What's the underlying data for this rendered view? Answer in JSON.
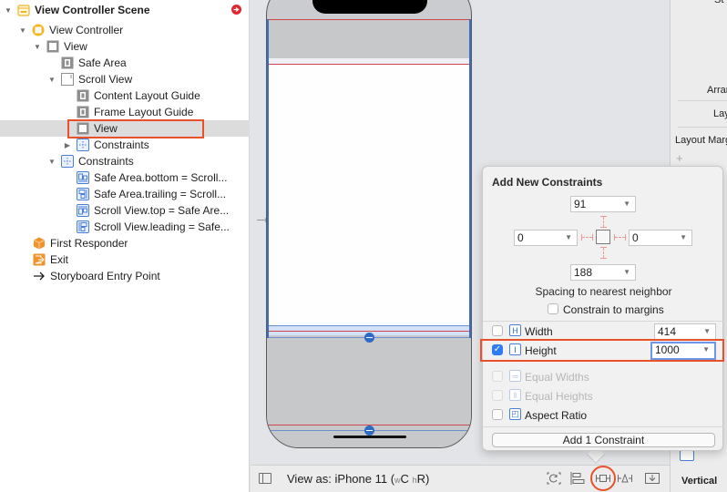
{
  "outline": {
    "items": [
      {
        "label": "View Controller Scene",
        "level": 0,
        "expanded": true,
        "icon": "scene-icon",
        "bold": true
      },
      {
        "label": "View Controller",
        "level": 1,
        "expanded": true,
        "icon": "view-controller-icon"
      },
      {
        "label": "View",
        "level": 2,
        "expanded": true,
        "icon": "view-icon"
      },
      {
        "label": "Safe Area",
        "level": 3,
        "icon": "layout-guide-icon"
      },
      {
        "label": "Scroll View",
        "level": 3,
        "expanded": true,
        "icon": "scroll-view-icon"
      },
      {
        "label": "Content Layout Guide",
        "level": 4,
        "icon": "layout-guide-icon"
      },
      {
        "label": "Frame Layout Guide",
        "level": 4,
        "icon": "layout-guide-icon"
      },
      {
        "label": "View",
        "level": 4,
        "icon": "view-icon",
        "selected": true
      },
      {
        "label": "Constraints",
        "level": 4,
        "expanded": false,
        "icon": "constraints-icon"
      },
      {
        "label": "Constraints",
        "level": 3,
        "expanded": true,
        "icon": "constraints-icon"
      },
      {
        "label": "Safe Area.bottom = Scroll...",
        "level": 4,
        "icon": "constraint-bottom-icon"
      },
      {
        "label": "Safe Area.trailing = Scroll...",
        "level": 4,
        "icon": "constraint-trailing-icon"
      },
      {
        "label": "Scroll View.top = Safe Are...",
        "level": 4,
        "icon": "constraint-top-icon"
      },
      {
        "label": "Scroll View.leading = Safe...",
        "level": 4,
        "icon": "constraint-leading-icon"
      },
      {
        "label": "First Responder",
        "level": 1,
        "icon": "first-responder-icon"
      },
      {
        "label": "Exit",
        "level": 1,
        "icon": "exit-icon"
      },
      {
        "label": "Storyboard Entry Point",
        "level": 1,
        "icon": "entry-arrow-icon"
      }
    ]
  },
  "toolbar": {
    "view_as_prefix": "View as: iPhone 11 (",
    "size_w_small": "w",
    "size_w": "C",
    "size_h_small": "h",
    "size_h": "R",
    "view_as_suffix": ")",
    "buttons": [
      "update-frames",
      "align",
      "add-new-constraints",
      "resolve-auto-layout",
      "embed-in"
    ]
  },
  "inspector": {
    "labels": [
      "St",
      "Arran",
      "Lay",
      "Layout Marg",
      "+",
      "Vertical"
    ]
  },
  "popover": {
    "title": "Add New Constraints",
    "top": "91",
    "left": "0",
    "right": "0",
    "bottom": "188",
    "spacing_caption": "Spacing to nearest neighbor",
    "constrain_margins_label": "Constrain to margins",
    "constrain_margins_checked": false,
    "width_label": "Width",
    "width_value": "414",
    "width_checked": false,
    "height_label": "Height",
    "height_value": "1000",
    "height_checked": true,
    "equal_widths_label": "Equal Widths",
    "equal_heights_label": "Equal Heights",
    "aspect_ratio_label": "Aspect Ratio",
    "aspect_ratio_checked": false,
    "add_button_label": "Add 1 Constraint"
  },
  "colors": {
    "highlight": "#e8522b",
    "accent": "#2f7cf6",
    "constraint_red": "#d0464a",
    "selection_blue": "#3d6cc4"
  }
}
